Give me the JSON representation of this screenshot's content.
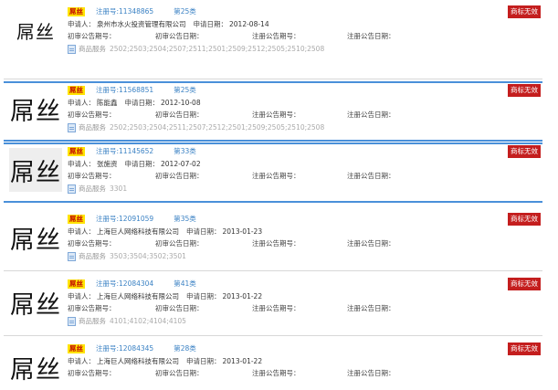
{
  "labels": {
    "reg_prefix": "注册号:",
    "applicant": "申请人：",
    "apply_date": "申请日期：",
    "first_trial_issue": "初审公告期号：",
    "first_trial_date": "初审公告日期：",
    "reg_issue": "注册公告期号：",
    "reg_date": "注册公告日期：",
    "service": "商品服务"
  },
  "records": [
    {
      "logo": "屌丝",
      "name": "屌丝",
      "reg_no": "注册号:11348865",
      "class": "第25类",
      "applicant": "泉州市水火投资管理有限公司",
      "apply_date": "2012-08-14",
      "services": "2502;2503;2504;2507;2511;2501;2509;2512;2505;2510;2508",
      "status": "商标无效"
    },
    {
      "logo": "屌丝",
      "name": "屌丝",
      "reg_no": "注册号:11568851",
      "class": "第25类",
      "applicant": "陈能鑫",
      "apply_date": "2012-10-08",
      "services": "2502;2503;2504;2511;2507;2512;2501;2509;2505;2510;2508",
      "status": "商标无效"
    },
    {
      "logo": "屌丝",
      "name": "屌丝",
      "reg_no": "注册号:11145652",
      "class": "第33类",
      "applicant": "张施资",
      "apply_date": "2012-07-02",
      "services": "3301",
      "status": "商标无效"
    },
    {
      "logo": "屌丝",
      "name": "屌丝",
      "reg_no": "注册号:12091059",
      "class": "第35类",
      "applicant": "上海巨人网络科技有限公司",
      "apply_date": "2013-01-23",
      "services": "3503;3504;3502;3501",
      "status": "商标无效"
    },
    {
      "logo": "屌丝",
      "name": "屌丝",
      "reg_no": "注册号:12084304",
      "class": "第41类",
      "applicant": "上海巨人网络科技有限公司",
      "apply_date": "2013-01-22",
      "services": "4101;4102;4104;4105",
      "status": "商标无效"
    },
    {
      "logo": "屌丝",
      "name": "屌丝",
      "reg_no": "注册号:12084345",
      "class": "第28类",
      "applicant": "上海巨人网络科技有限公司",
      "apply_date": "2013-01-22",
      "services": "",
      "status": "商标无效"
    }
  ],
  "colors": {
    "status_bg": "#c41e1e",
    "name_tag_bg": "#ffe400",
    "link": "#3b82c4",
    "active_border": "#4a90d9"
  }
}
